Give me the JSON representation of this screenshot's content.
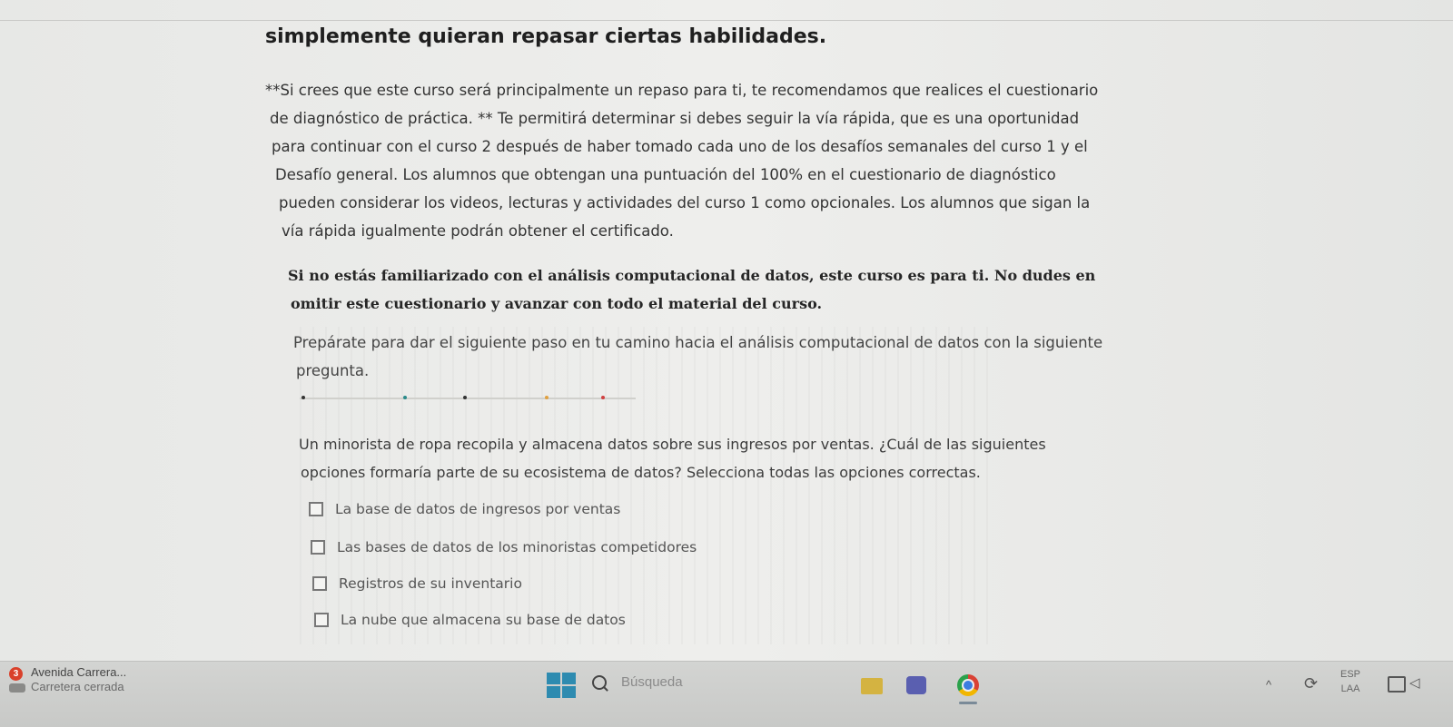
{
  "content": {
    "heading": "simplemente quieran repasar ciertas habilidades.",
    "paragraph1": [
      "**Si crees que este curso será principalmente un repaso para ti, te recomendamos que realices el cuestionario",
      "de diagnóstico de práctica. ** Te permitirá determinar si debes seguir la vía rápida, que es una oportunidad",
      "para continuar con el curso 2 después de haber tomado cada uno de los desafíos semanales del curso 1 y el",
      "Desafío general. Los alumnos que obtengan una puntuación del 100% en el cuestionario de diagnóstico",
      "pueden considerar los videos, lecturas y actividades del curso 1 como opcionales. Los alumnos que sigan la",
      "vía rápida igualmente podrán obtener el certificado."
    ],
    "paragraph2": [
      "Si no estás familiarizado con el análisis computacional de datos, este curso es para ti. No dudes en",
      "omitir este cuestionario y avanzar con todo el material del curso."
    ],
    "paragraph3": [
      "Prepárate para dar el siguiente paso en tu camino hacia el análisis computacional de datos con la siguiente",
      "pregunta."
    ],
    "question": [
      "Un minorista de ropa recopila y almacena datos sobre sus ingresos por ventas. ¿Cuál de las siguientes",
      "opciones formaría parte de su ecosistema de datos? Selecciona todas las opciones correctas."
    ],
    "options": [
      "La base de datos de ingresos por ventas",
      "Las bases de datos de los minoristas competidores",
      "Registros de su inventario",
      "La nube que almacena su base de datos"
    ],
    "separator_dot_colors": [
      "#333333",
      "#2a8a8a",
      "#333333",
      "#e0a040",
      "#d04040"
    ]
  },
  "taskbar": {
    "weather_badge": "3",
    "weather_title": "Avenida Carrera...",
    "weather_subtitle": "Carretera cerrada",
    "search_placeholder": "Búsqueda",
    "language_top": "ESP",
    "language_bottom": "LAA",
    "tray_chevron": "^"
  }
}
